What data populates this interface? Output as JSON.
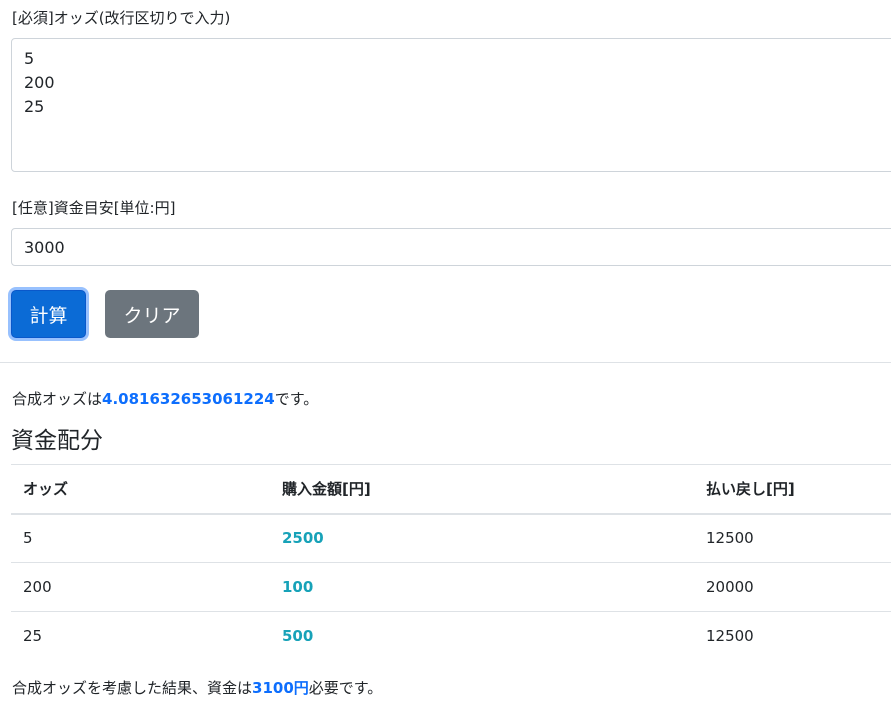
{
  "form": {
    "odds_label": "[必須]オッズ(改行区切りで入力)",
    "odds_value": "5\n200\n25",
    "budget_label": "[任意]資金目安[単位:円]",
    "budget_value": "3000",
    "calc_button": "計算",
    "clear_button": "クリア"
  },
  "result": {
    "synth_prefix": "合成オッズは",
    "synth_value": "4.081632653061224",
    "synth_suffix": "です。",
    "section_title": "資金配分",
    "table": {
      "headers": [
        "オッズ",
        "購入金額[円]",
        "払い戻し[円]"
      ],
      "rows": [
        {
          "odds": "5",
          "amount": "2500",
          "payout": "12500"
        },
        {
          "odds": "200",
          "amount": "100",
          "payout": "20000"
        },
        {
          "odds": "25",
          "amount": "500",
          "payout": "12500"
        }
      ]
    },
    "total_prefix": "合成オッズを考慮した結果、資金は",
    "total_value": "3100円",
    "total_suffix": "必要です。"
  },
  "colors": {
    "primary": "#0b6bd6",
    "secondary": "#6c757d",
    "highlight": "#0d6efd",
    "amount": "#17a2b8"
  }
}
